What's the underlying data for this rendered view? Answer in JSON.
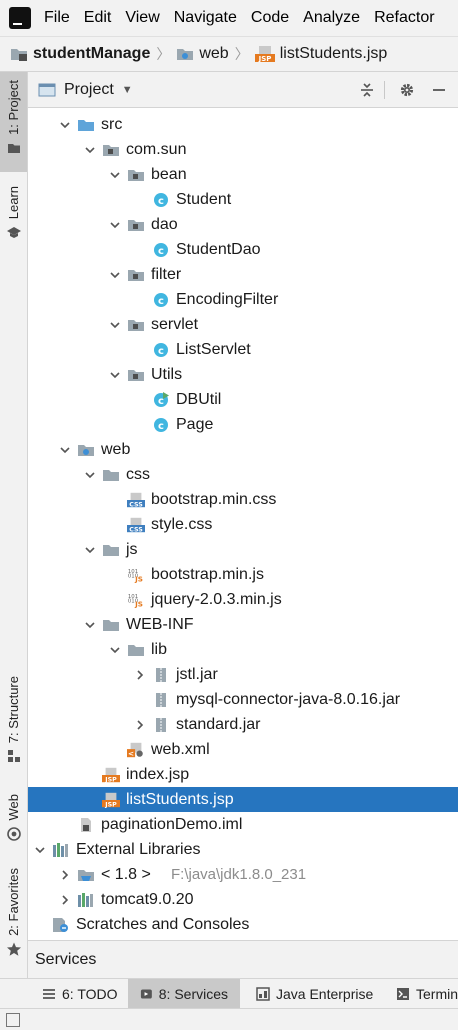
{
  "menu": [
    "File",
    "Edit",
    "View",
    "Navigate",
    "Code",
    "Analyze",
    "Refactor"
  ],
  "breadcrumb": {
    "project": "studentManage",
    "folder": "web",
    "file": "listStudents.jsp"
  },
  "left_tabs": {
    "project": "1: Project",
    "learn": "Learn",
    "structure": "7: Structure",
    "web": "Web",
    "favorites": "2: Favorites"
  },
  "panel": {
    "title": "Project"
  },
  "tree": [
    {
      "label": "src",
      "depth": 1,
      "arrow": "down",
      "icon": "src-folder-icon"
    },
    {
      "label": "com.sun",
      "depth": 2,
      "arrow": "down",
      "icon": "package-icon"
    },
    {
      "label": "bean",
      "depth": 3,
      "arrow": "down",
      "icon": "package-icon"
    },
    {
      "label": "Student",
      "depth": 4,
      "arrow": "",
      "icon": "class-icon"
    },
    {
      "label": "dao",
      "depth": 3,
      "arrow": "down",
      "icon": "package-icon"
    },
    {
      "label": "StudentDao",
      "depth": 4,
      "arrow": "",
      "icon": "class-icon"
    },
    {
      "label": "filter",
      "depth": 3,
      "arrow": "down",
      "icon": "package-icon"
    },
    {
      "label": "EncodingFilter",
      "depth": 4,
      "arrow": "",
      "icon": "class-icon"
    },
    {
      "label": "servlet",
      "depth": 3,
      "arrow": "down",
      "icon": "package-icon"
    },
    {
      "label": "ListServlet",
      "depth": 4,
      "arrow": "",
      "icon": "class-icon"
    },
    {
      "label": "Utils",
      "depth": 3,
      "arrow": "down",
      "icon": "package-icon"
    },
    {
      "label": "DBUtil",
      "depth": 4,
      "arrow": "",
      "icon": "class-run-icon"
    },
    {
      "label": "Page",
      "depth": 4,
      "arrow": "",
      "icon": "class-icon"
    },
    {
      "label": "web",
      "depth": 1,
      "arrow": "down",
      "icon": "web-folder-icon"
    },
    {
      "label": "css",
      "depth": 2,
      "arrow": "down",
      "icon": "folder-icon"
    },
    {
      "label": "bootstrap.min.css",
      "depth": 3,
      "arrow": "",
      "icon": "css-file-icon"
    },
    {
      "label": "style.css",
      "depth": 3,
      "arrow": "",
      "icon": "css-file-icon"
    },
    {
      "label": "js",
      "depth": 2,
      "arrow": "down",
      "icon": "folder-icon"
    },
    {
      "label": "bootstrap.min.js",
      "depth": 3,
      "arrow": "",
      "icon": "js-file-icon"
    },
    {
      "label": "jquery-2.0.3.min.js",
      "depth": 3,
      "arrow": "",
      "icon": "js-file-icon"
    },
    {
      "label": "WEB-INF",
      "depth": 2,
      "arrow": "down",
      "icon": "folder-icon"
    },
    {
      "label": "lib",
      "depth": 3,
      "arrow": "down",
      "icon": "folder-icon"
    },
    {
      "label": "jstl.jar",
      "depth": 4,
      "arrow": "right",
      "icon": "jar-icon"
    },
    {
      "label": "mysql-connector-java-8.0.16.jar",
      "depth": 4,
      "arrow": "",
      "icon": "jar-icon"
    },
    {
      "label": "standard.jar",
      "depth": 4,
      "arrow": "right",
      "icon": "jar-icon"
    },
    {
      "label": "web.xml",
      "depth": 3,
      "arrow": "",
      "icon": "xml-file-icon"
    },
    {
      "label": "index.jsp",
      "depth": 2,
      "arrow": "",
      "icon": "jsp-file-icon"
    },
    {
      "label": "listStudents.jsp",
      "depth": 2,
      "arrow": "",
      "icon": "jsp-file-icon",
      "selected": true
    },
    {
      "label": "paginationDemo.iml",
      "depth": 1,
      "arrow": "",
      "icon": "iml-file-icon"
    },
    {
      "label": "External Libraries",
      "depth": 0,
      "arrow": "down",
      "icon": "libraries-icon"
    },
    {
      "label": "< 1.8 >",
      "hint": "F:\\java\\jdk1.8.0_231",
      "depth": 1,
      "arrow": "right",
      "icon": "jdk-icon"
    },
    {
      "label": "tomcat9.0.20",
      "depth": 1,
      "arrow": "right",
      "icon": "libraries-icon"
    },
    {
      "label": "Scratches and Consoles",
      "depth": 0,
      "arrow": "",
      "icon": "scratches-icon"
    }
  ],
  "services_panel": {
    "title": "Services"
  },
  "bottom_tabs": [
    {
      "label": "6: TODO",
      "icon": "todo-icon"
    },
    {
      "label": "8: Services",
      "icon": "services-icon",
      "active": true
    },
    {
      "label": "Java Enterprise",
      "icon": "java-enterprise-icon"
    },
    {
      "label": "Terminal",
      "icon": "terminal-icon"
    }
  ],
  "colors": {
    "selection": "#2675bf",
    "folder": "#9aa7b0",
    "class_icon": "#40b6e0",
    "jsp_badge": "#e57a20"
  }
}
